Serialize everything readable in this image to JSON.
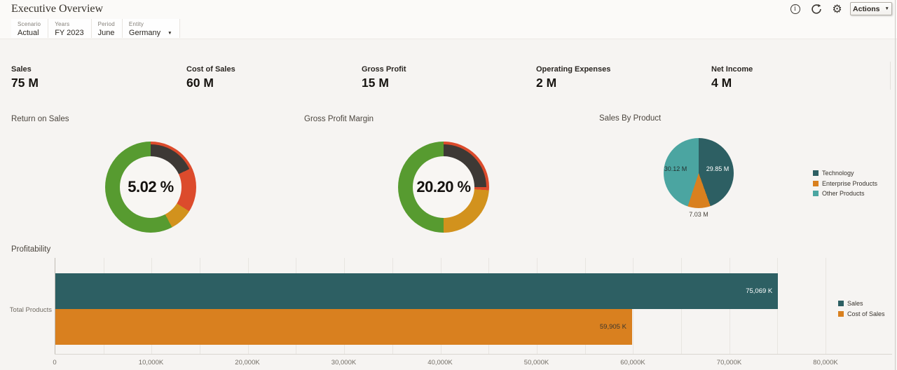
{
  "header": {
    "title": "Executive Overview",
    "actions_label": "Actions",
    "icons": {
      "info_glyph": "i",
      "settings_glyph": "⚙",
      "dropdown_glyph": "▼",
      "refresh": "circular-arrow"
    }
  },
  "pov": {
    "items": [
      {
        "label": "Scenario",
        "value": "Actual"
      },
      {
        "label": "Years",
        "value": "FY 2023"
      },
      {
        "label": "Period",
        "value": "June"
      },
      {
        "label": "Entity",
        "value": "Germany"
      }
    ]
  },
  "kpis": [
    {
      "label": "Sales",
      "value": "75 M"
    },
    {
      "label": "Cost of Sales",
      "value": "60 M"
    },
    {
      "label": "Gross Profit",
      "value": "15 M"
    },
    {
      "label": "Operating Expenses",
      "value": "2 M"
    },
    {
      "label": "Net Income",
      "value": "4 M"
    }
  ],
  "colors": {
    "teal_dark": "#2d5f63",
    "orange": "#d9801f",
    "teal_light": "#4ba5a1",
    "green": "#579b30",
    "red": "#dc4b2c",
    "amber": "#d2921d",
    "indicator_dark": "#3d3935"
  },
  "chart_data": [
    {
      "type": "gauge",
      "title": "Return on Sales",
      "value": 5.02,
      "unit": "%",
      "value_label": "5.02 %",
      "segments": [
        {
          "color": "#dc4b2c",
          "from": 0,
          "to": 122
        },
        {
          "color": "#d2921d",
          "from": 122,
          "to": 152
        },
        {
          "color": "#579b30",
          "from": 152,
          "to": 360
        }
      ],
      "indicator": {
        "color": "#3d3935",
        "from": 0,
        "to": 65
      }
    },
    {
      "type": "gauge",
      "title": "Gross Profit Margin",
      "value": 20.2,
      "unit": "%",
      "value_label": "20.20 %",
      "segments": [
        {
          "color": "#dc4b2c",
          "from": 0,
          "to": 94
        },
        {
          "color": "#d2921d",
          "from": 94,
          "to": 180
        },
        {
          "color": "#579b30",
          "from": 180,
          "to": 360
        }
      ],
      "indicator": {
        "color": "#3d3935",
        "from": 0,
        "to": 90
      }
    },
    {
      "type": "pie",
      "title": "Sales By Product",
      "legend_position": "right",
      "slices": [
        {
          "label": "Technology",
          "value": 29.85,
          "display": "29.85 M",
          "color": "#2d5f63"
        },
        {
          "label": "Enterprise Products",
          "value": 7.03,
          "display": "7.03 M",
          "color": "#d9801f"
        },
        {
          "label": "Other Products",
          "value": 30.12,
          "display": "30.12 M",
          "color": "#4ba5a1"
        }
      ]
    },
    {
      "type": "bar",
      "title": "Profitability",
      "orientation": "horizontal",
      "categories": [
        "Total Products"
      ],
      "series": [
        {
          "name": "Sales",
          "value": 75069,
          "display": "75,069 K",
          "color": "#2d5f63"
        },
        {
          "name": "Cost of Sales",
          "value": 59905,
          "display": "59,905 K",
          "color": "#d9801f"
        }
      ],
      "x_max": 80000,
      "x_tick_step": 10000,
      "gridline_step": 5000,
      "x_ticks": [
        "0",
        "10,000K",
        "20,000K",
        "30,000K",
        "40,000K",
        "50,000K",
        "60,000K",
        "70,000K",
        "80,000K"
      ],
      "legend_position": "right",
      "grid": true
    }
  ]
}
